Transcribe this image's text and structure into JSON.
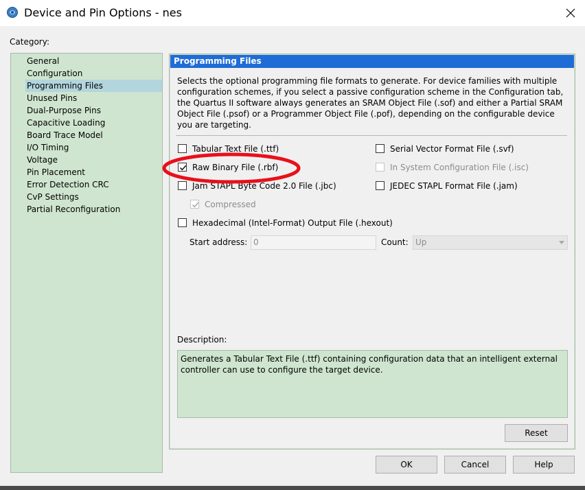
{
  "window": {
    "title": "Device and Pin Options - nes",
    "icon": "quartus-app-icon",
    "close_icon": "close-icon"
  },
  "category": {
    "label": "Category:",
    "items": [
      "General",
      "Configuration",
      "Programming Files",
      "Unused Pins",
      "Dual-Purpose Pins",
      "Capacitive Loading",
      "Board Trace Model",
      "I/O Timing",
      "Voltage",
      "Pin Placement",
      "Error Detection CRC",
      "CvP Settings",
      "Partial Reconfiguration"
    ],
    "selected": "Programming Files"
  },
  "panel": {
    "header": "Programming Files",
    "intro": "Selects the optional programming file formats to generate. For device families with multiple configuration schemes, if you select a passive configuration scheme in the Configuration tab, the Quartus II software always generates an SRAM Object File (.sof) and either a Partial SRAM Object File (.psof) or a Programmer Object File (.pof), depending on the configurable device you are targeting.",
    "options": {
      "ttf": {
        "label": "Tabular Text File (.ttf)",
        "checked": false,
        "enabled": true
      },
      "rbf": {
        "label": "Raw Binary File (.rbf)",
        "checked": true,
        "enabled": true
      },
      "jbc": {
        "label": "Jam STAPL Byte Code 2.0 File (.jbc)",
        "checked": false,
        "enabled": true
      },
      "compressed": {
        "label": "Compressed",
        "checked": true,
        "enabled": false
      },
      "hexout": {
        "label": "Hexadecimal (Intel-Format) Output File (.hexout)",
        "checked": false,
        "enabled": true
      },
      "svf": {
        "label": "Serial Vector Format File (.svf)",
        "checked": false,
        "enabled": true
      },
      "isc": {
        "label": "In System Configuration File (.isc)",
        "checked": false,
        "enabled": false
      },
      "jam": {
        "label": "JEDEC STAPL Format File (.jam)",
        "checked": false,
        "enabled": true
      }
    },
    "start_address": {
      "label": "Start address:",
      "value": "0"
    },
    "count": {
      "label": "Count:",
      "value": "Up"
    },
    "description": {
      "label": "Description:",
      "text": "Generates a Tabular Text File (.ttf) containing configuration data that an intelligent external controller can use to configure the target device."
    },
    "reset_label": "Reset"
  },
  "footer": {
    "ok_label": "OK",
    "cancel_label": "Cancel",
    "help_label": "Help"
  },
  "colors": {
    "panel_header_bg": "#1f6cd6",
    "list_bg": "#cfe5cf",
    "selection_bg": "#b3d5dd",
    "highlight_ellipse": "#e8101a"
  }
}
